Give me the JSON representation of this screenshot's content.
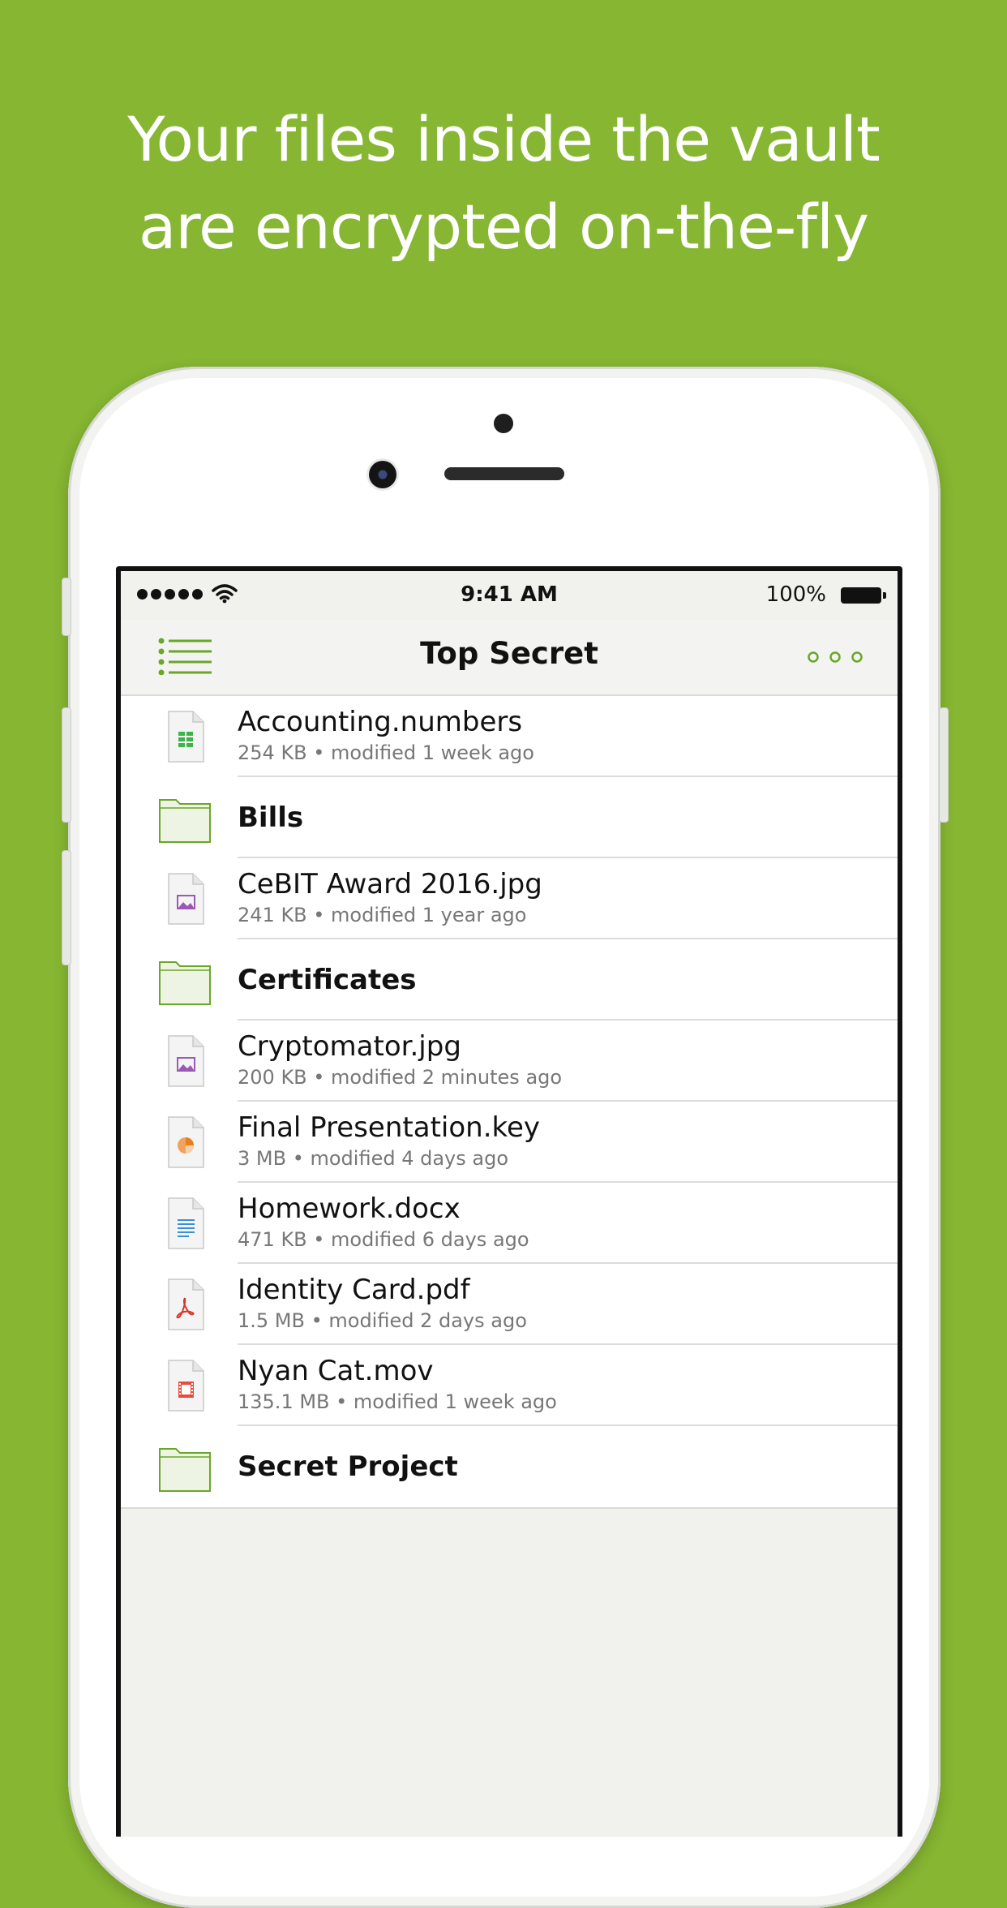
{
  "headline": {
    "line1": "Your files inside the vault",
    "line2": "are encrypted on-the-fly"
  },
  "status_bar": {
    "time": "9:41 AM",
    "battery": "100%"
  },
  "navbar": {
    "title": "Top Secret"
  },
  "items": [
    {
      "kind": "file",
      "icon": "numbers-file-icon",
      "name": "Accounting.numbers",
      "meta": "254 KB • modified 1 week ago"
    },
    {
      "kind": "folder",
      "icon": "folder-icon",
      "name": "Bills"
    },
    {
      "kind": "file",
      "icon": "image-file-icon",
      "name": "CeBIT Award 2016.jpg",
      "meta": "241 KB • modified 1 year ago"
    },
    {
      "kind": "folder",
      "icon": "folder-icon",
      "name": "Certificates"
    },
    {
      "kind": "file",
      "icon": "image-file-icon",
      "name": "Cryptomator.jpg",
      "meta": "200 KB • modified 2 minutes ago"
    },
    {
      "kind": "file",
      "icon": "keynote-file-icon",
      "name": "Final Presentation.key",
      "meta": "3 MB • modified 4 days ago"
    },
    {
      "kind": "file",
      "icon": "document-file-icon",
      "name": "Homework.docx",
      "meta": "471 KB • modified 6 days ago"
    },
    {
      "kind": "file",
      "icon": "pdf-file-icon",
      "name": "Identity Card.pdf",
      "meta": "1.5 MB • modified 2 days ago"
    },
    {
      "kind": "file",
      "icon": "video-file-icon",
      "name": "Nyan Cat.mov",
      "meta": "135.1 MB • modified 1 week ago"
    },
    {
      "kind": "folder",
      "icon": "folder-icon",
      "name": "Secret Project"
    }
  ],
  "colors": {
    "background": "#86b632",
    "accent": "#6aa628"
  }
}
